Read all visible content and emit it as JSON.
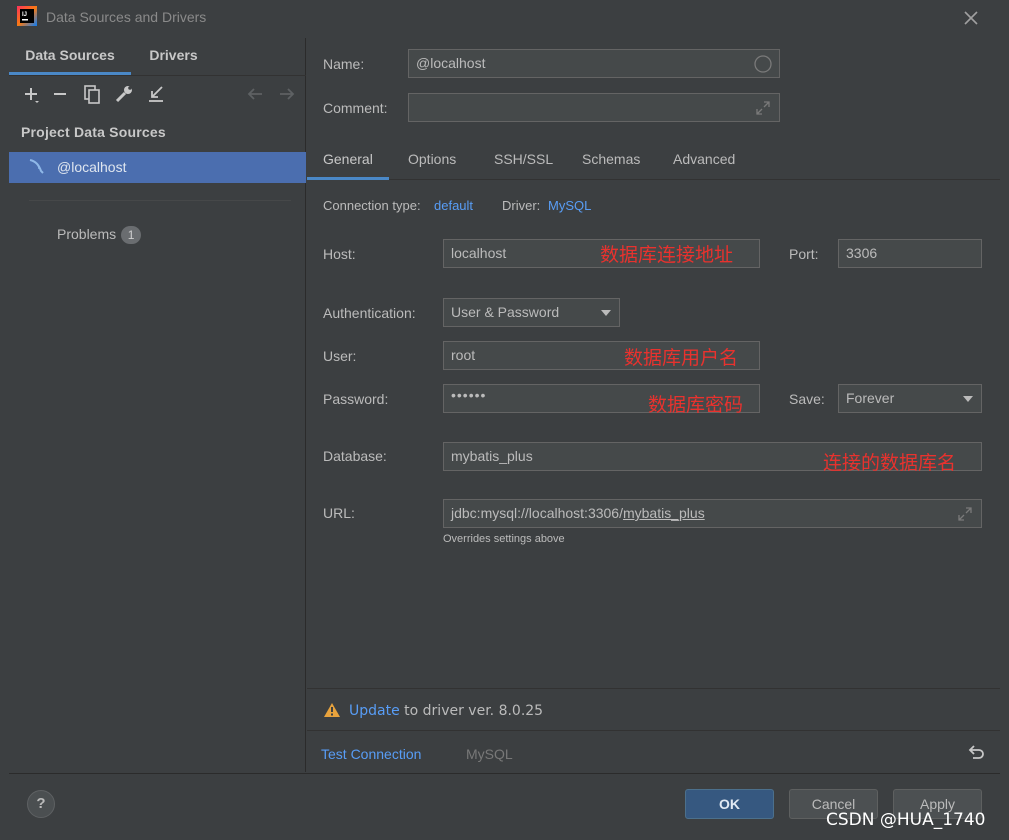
{
  "window": {
    "title": "Data Sources and Drivers"
  },
  "sidebar": {
    "tabs": [
      "Data Sources",
      "Drivers"
    ],
    "section_header": "Project Data Sources",
    "selected_item": "@localhost",
    "problems_label": "Problems",
    "problems_count": "1"
  },
  "form": {
    "name_label": "Name:",
    "name_value": "@localhost",
    "comment_label": "Comment:",
    "comment_value": "",
    "tabs": [
      "General",
      "Options",
      "SSH/SSL",
      "Schemas",
      "Advanced"
    ],
    "connection_type_label": "Connection type:",
    "connection_type_value": "default",
    "driver_label": "Driver:",
    "driver_value": "MySQL",
    "host_label": "Host:",
    "host_value": "localhost",
    "host_note": "数据库连接地址",
    "port_label": "Port:",
    "port_value": "3306",
    "auth_label": "Authentication:",
    "auth_value": "User & Password",
    "user_label": "User:",
    "user_value": "root",
    "user_note": "数据库用户名",
    "password_label": "Password:",
    "password_value": "••••••",
    "password_note": "数据库密码",
    "save_label": "Save:",
    "save_value": "Forever",
    "database_label": "Database:",
    "database_value": "mybatis_plus",
    "database_note": "连接的数据库名",
    "url_label": "URL:",
    "url_prefix": "jdbc:mysql://localhost:3306/",
    "url_db": "mybatis_plus",
    "url_hint": "Overrides settings above"
  },
  "update": {
    "link": "Update",
    "text": " to driver ver. 8.0.25"
  },
  "test": {
    "button": "Test Connection",
    "driver": "MySQL"
  },
  "footer": {
    "help": "?",
    "ok": "OK",
    "cancel": "Cancel",
    "apply": "Apply"
  },
  "watermark": "CSDN @HUA_1740",
  "colors": {
    "accent": "#4a88c7",
    "link": "#589df6",
    "annotation": "#e8322e",
    "selection": "#4b6eaf"
  }
}
